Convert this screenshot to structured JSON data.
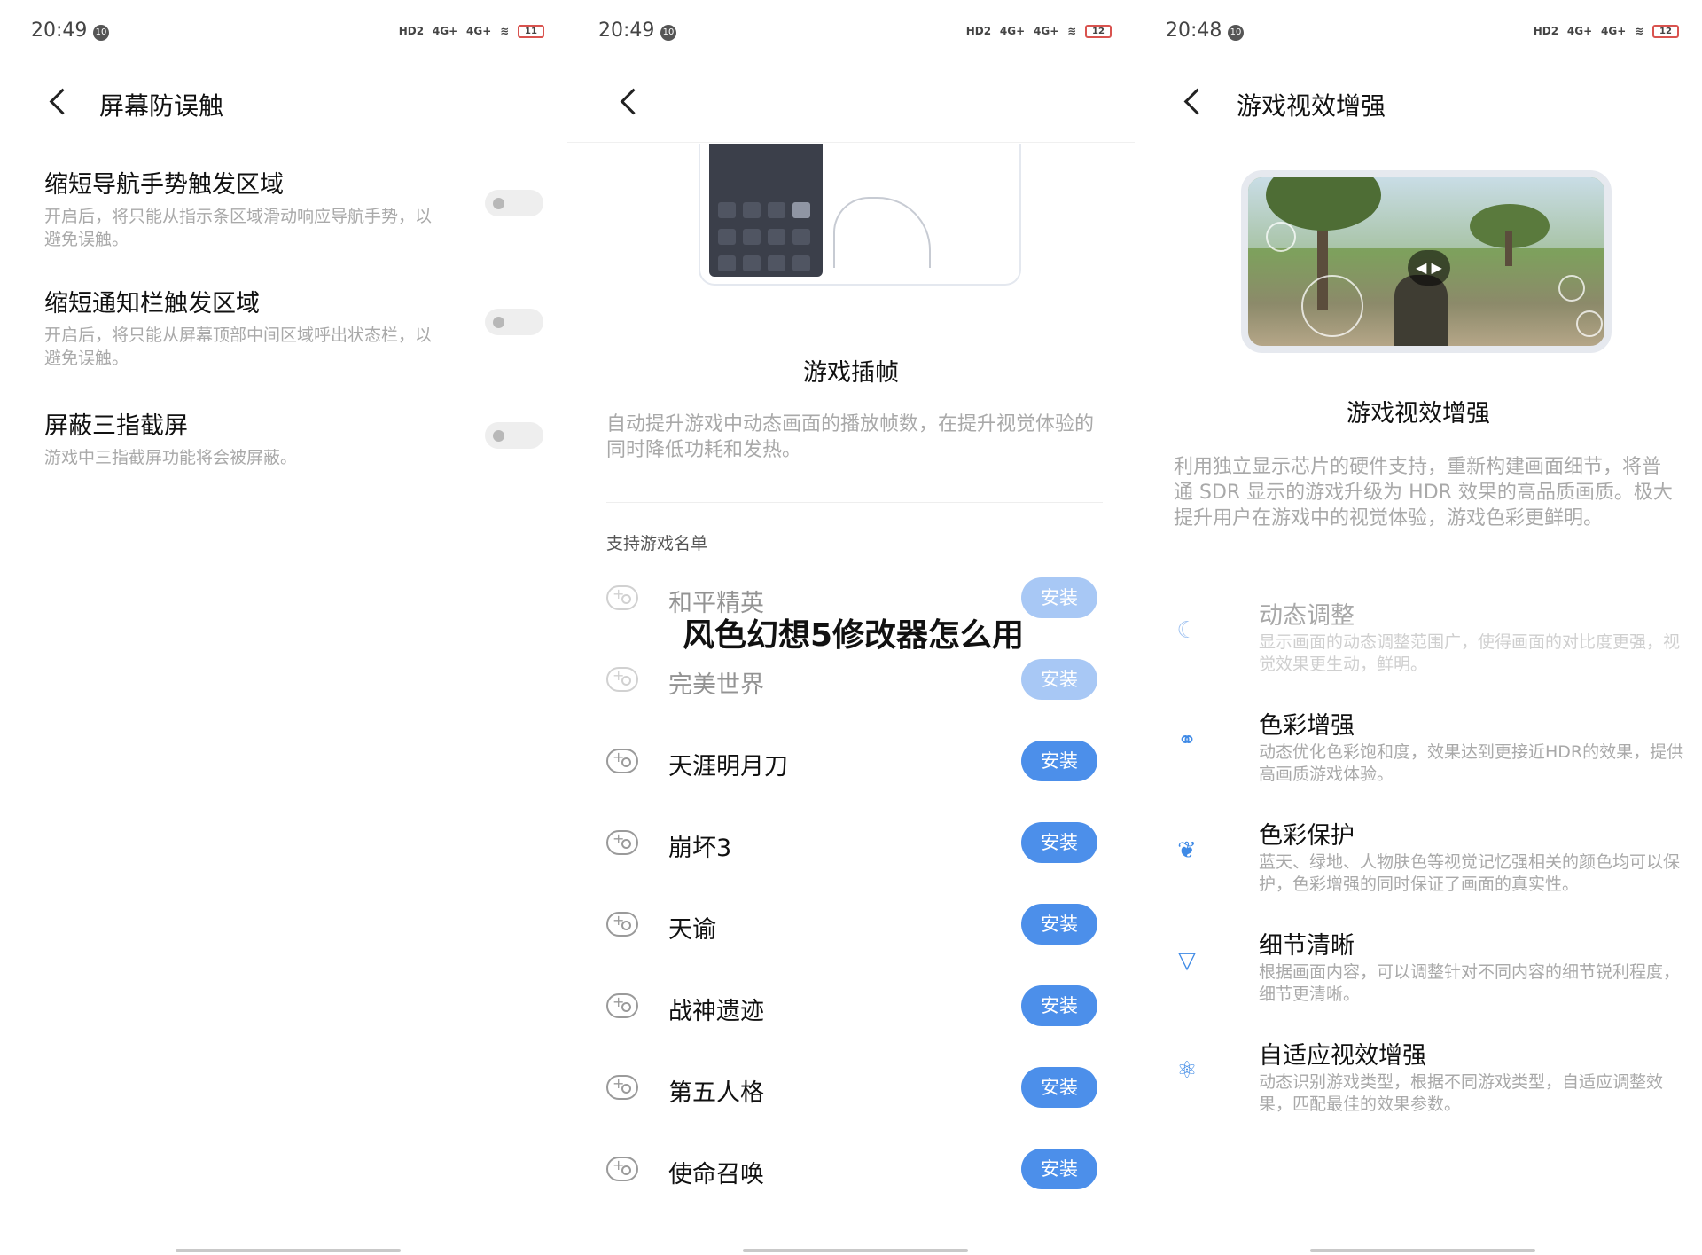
{
  "status_bars": [
    {
      "time": "20:49",
      "notif": "10",
      "net": [
        "HD2",
        "4G+",
        "4G+"
      ],
      "battery": "11"
    },
    {
      "time": "20:49",
      "notif": "10",
      "net": [
        "HD2",
        "4G+",
        "4G+"
      ],
      "battery": "12"
    },
    {
      "time": "20:48",
      "notif": "10",
      "net": [
        "HD2",
        "4G+",
        "4G+"
      ],
      "battery": "12"
    }
  ],
  "panel1": {
    "title": "屏幕防误触",
    "settings": [
      {
        "title": "缩短导航手势触发区域",
        "desc": "开启后，将只能从指示条区域滑动响应导航手势，以避免误触。",
        "enabled": false
      },
      {
        "title": "缩短通知栏触发区域",
        "desc": "开启后，将只能从屏幕顶部中间区域呼出状态栏，以避免误触。",
        "enabled": false
      },
      {
        "title": "屏蔽三指截屏",
        "desc": "游戏中三指截屏功能将会被屏蔽。",
        "enabled": false
      }
    ]
  },
  "panel2": {
    "feature_title": "游戏插帧",
    "feature_desc": "自动提升游戏中动态画面的播放帧数，在提升视觉体验的同时降低功耗和发热。",
    "list_label": "支持游戏名单",
    "install_label": "安装",
    "games": [
      "和平精英",
      "完美世界",
      "天涯明月刀",
      "崩坏3",
      "天谕",
      "战神遗迹",
      "第五人格",
      "使命召唤"
    ]
  },
  "overlay_text": "风色幻想5修改器怎么用",
  "panel3": {
    "title": "游戏视效增强",
    "feature_title": "游戏视效增强",
    "feature_desc": "利用独立显示芯片的硬件支持，重新构建画面细节，将普通 SDR 显示的游戏升级为 HDR 效果的高品质画质。极大提升用户在游戏中的视觉体验，游戏色彩更鲜明。",
    "accent_color": "#3f8ae6",
    "features": [
      {
        "icon": "moon-icon",
        "title": "动态调整",
        "desc": "显示画面的动态调整范围广，使得画面的对比度更强，视觉效果更生动，鲜明。"
      },
      {
        "icon": "color-circles-icon",
        "title": "色彩增强",
        "desc": "动态优化色彩饱和度，效果达到更接近HDR的效果，提供高画质游戏体验。"
      },
      {
        "icon": "leaf-icon",
        "title": "色彩保护",
        "desc": "蓝天、绿地、人物肤色等视觉记忆强相关的颜色均可以保护，色彩增强的同时保证了画面的真实性。"
      },
      {
        "icon": "diamond-icon",
        "title": "细节清晰",
        "desc": "根据画面内容，可以调整针对不同内容的细节锐利程度，细节更清晰。"
      },
      {
        "icon": "atom-icon",
        "title": "自适应视效增强",
        "desc": "动态识别游戏类型，根据不同游戏类型，自适应调整效果，匹配最佳的效果参数。"
      }
    ]
  }
}
